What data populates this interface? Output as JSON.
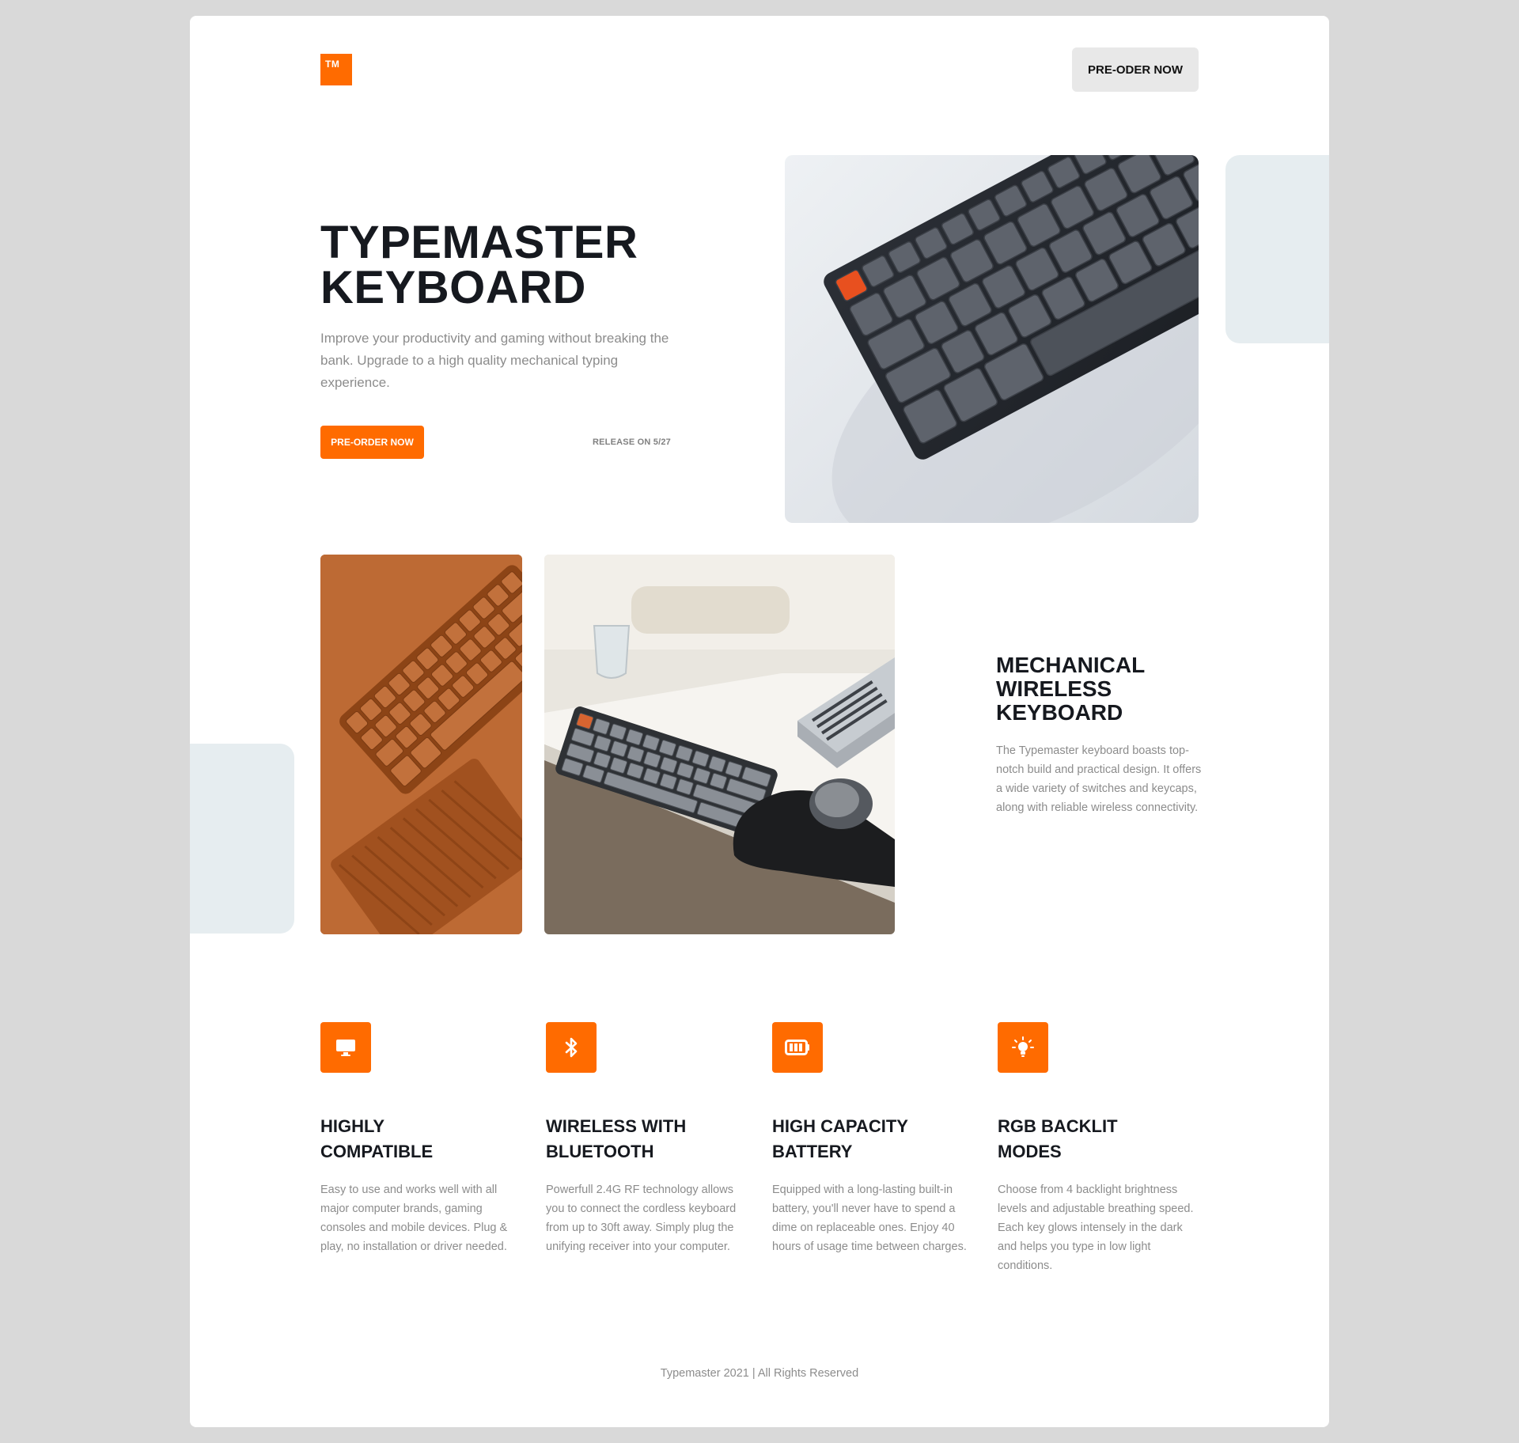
{
  "header": {
    "logo_text": "TM",
    "preorder_label": "PRE-ODER NOW"
  },
  "hero": {
    "title_line1": "TYPEMASTER",
    "title_line2": "KEYBOARD",
    "description": "Improve your productivity and gaming without breaking the bank. Upgrade to a high quality mechanical typing experience.",
    "cta_label": "PRE-ORDER NOW",
    "release_text": "RELEASE ON 5/27"
  },
  "section2": {
    "title_line1": "MECHANICAL",
    "title_line2": "WIRELESS",
    "title_line3": "KEYBOARD",
    "description": "The Typemaster keyboard boasts top-notch build and practical design. It offers a wide variety of switches and keycaps, along with reliable wireless connectivity."
  },
  "features": [
    {
      "icon": "monitor-icon",
      "title_line1": "HIGHLY",
      "title_line2": "COMPATIBLE",
      "description": "Easy to use and works well with all major computer brands, gaming consoles and mobile devices. Plug & play, no installation or driver needed."
    },
    {
      "icon": "bluetooth-icon",
      "title_line1": "WIRELESS WITH",
      "title_line2": "BLUETOOTH",
      "description": "Powerfull 2.4G RF technology allows you to connect the cordless keyboard from up to 30ft away. Simply plug the unifying receiver into your computer."
    },
    {
      "icon": "battery-icon",
      "title_line1": "HIGH CAPACITY",
      "title_line2": "BATTERY",
      "description": "Equipped with a long-lasting built-in battery, you'll never have to spend a dime on replaceable ones. Enjoy 40 hours of usage time between charges."
    },
    {
      "icon": "lightbulb-icon",
      "title_line1": "RGB BACKLIT",
      "title_line2": "MODES",
      "description": "Choose from 4 backlight brightness levels and adjustable breathing speed. Each key glows intensely in the dark and helps you type in low light conditions."
    }
  ],
  "footer": {
    "text": "Typemaster 2021 | All Rights Reserved"
  },
  "colors": {
    "accent": "#ff6b00",
    "heading": "#16191f",
    "muted": "#8c8c8c",
    "page_bg": "#d9d9d9",
    "deco": "#e6edf0"
  }
}
